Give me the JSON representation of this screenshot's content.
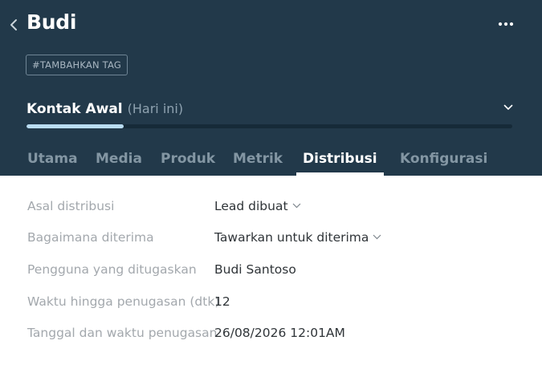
{
  "header": {
    "title": "Budi",
    "tag_button": "#TAMBAHKAN TAG",
    "stage": {
      "name": "Kontak Awal",
      "when": "(Hari ini)",
      "progress_fraction": 0.2
    },
    "tabs": [
      {
        "label": "Utama",
        "active": false
      },
      {
        "label": "Media",
        "active": false
      },
      {
        "label": "Produk",
        "active": false
      },
      {
        "label": "Metrik",
        "active": false
      },
      {
        "label": "Distribusi",
        "active": true
      },
      {
        "label": "Konfigurasi",
        "active": false
      }
    ]
  },
  "fields": [
    {
      "label": "Asal distribusi",
      "value": "Lead dibuat",
      "dropdown": true
    },
    {
      "label": "Bagaimana diterima",
      "value": "Tawarkan untuk diterima",
      "dropdown": true
    },
    {
      "label": "Pengguna yang ditugaskan",
      "value": "Budi Santoso",
      "dropdown": false
    },
    {
      "label": "Waktu hingga penugasan (dtk)",
      "value": "12",
      "dropdown": false
    },
    {
      "label": "Tanggal dan waktu penugasan",
      "value": "26/08/2026 12:01AM",
      "dropdown": false
    }
  ],
  "icons": {
    "back": "back-chevron-icon",
    "more": "more-dots-icon",
    "stage_toggle": "chevron-down-icon",
    "dropdown": "chevron-down-icon"
  },
  "colors": {
    "header_bg": "#22394a",
    "progress_fill": "#b9dcf2",
    "label_text": "#a3a8ad",
    "value_text": "#2f3438"
  }
}
